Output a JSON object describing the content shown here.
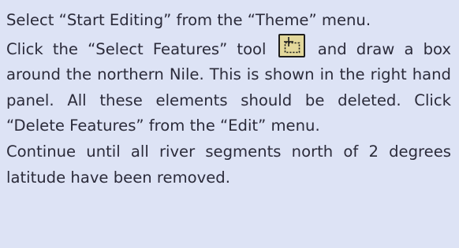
{
  "instructions": {
    "step1": "Select “Start Editing” from the “Theme” menu.",
    "step2_before_icon": "Click the “Select Features” tool",
    "step2_after_icon": "and draw a box around the northern Nile. This is shown in the right hand panel. All these elements should be deleted. Click “Delete Features” from the “Edit” menu.",
    "step3": "Continue until all river segments north of 2 degrees latitude have been removed.",
    "tool_icon": "select-features-tool-icon"
  },
  "colors": {
    "background": "#dde3f5",
    "text": "#2b2b3a",
    "icon_fill": "#e3d89b",
    "icon_border": "#1e1e1e"
  }
}
